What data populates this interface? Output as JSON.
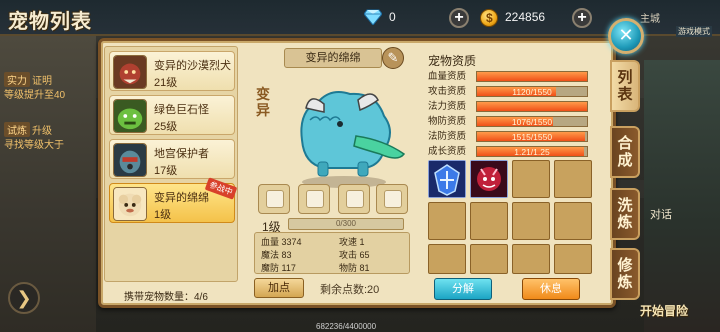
{
  "header": {
    "title": "宠物列表",
    "gems": "0",
    "coins": "224856",
    "minimap_label": "主城",
    "mode_label": "游戏模式"
  },
  "left_hints": [
    {
      "tag": "实力",
      "text": "证明"
    },
    {
      "tag": "",
      "text": "等级提升至40"
    },
    {
      "tag": "试炼",
      "text": "升级"
    },
    {
      "tag": "",
      "text": "寻找等级大于"
    }
  ],
  "pets": [
    {
      "name": "变异的沙漠烈犬",
      "level": "21级",
      "color": "#b04030"
    },
    {
      "name": "绿色巨石怪",
      "level": "25级",
      "color": "#4a9a30"
    },
    {
      "name": "地宫保护者",
      "level": "17级",
      "color": "#5a7a8a"
    },
    {
      "name": "变异的绵绵",
      "level": "1级",
      "color": "#e8d2a8",
      "selected": true,
      "badge": "参战中"
    }
  ],
  "carry_label": "携带宠物数量：4/6",
  "selected_pet": {
    "name": "变异的绵绵",
    "variant_tag": "变异",
    "level_label": "1级",
    "exp": "0/300",
    "stats": {
      "hp_label": "血量",
      "hp": "3374",
      "atk_speed_label": "攻速",
      "atk_speed": "1",
      "mp_label": "魔法",
      "mp": "83",
      "atk_label": "攻击",
      "atk": "65",
      "mdef_label": "魔防",
      "mdef": "117",
      "pdef_label": "物防",
      "pdef": "81"
    },
    "add_point_label": "加点",
    "remaining_points": "剩余点数:20"
  },
  "aptitude": {
    "title": "宠物资质",
    "rows": [
      {
        "label": "血量资质",
        "value": "",
        "fill": 1.0
      },
      {
        "label": "攻击资质",
        "value": "1120/1550",
        "fill": 0.72
      },
      {
        "label": "法力资质",
        "value": "",
        "fill": 1.0
      },
      {
        "label": "物防资质",
        "value": "1076/1550",
        "fill": 0.69
      },
      {
        "label": "法防资质",
        "value": "1515/1550",
        "fill": 0.98
      },
      {
        "label": "成长资质",
        "value": "1.21/1.25",
        "fill": 0.97
      }
    ]
  },
  "actions": {
    "decompose": "分解",
    "rest": "休息"
  },
  "side_tabs": [
    {
      "label": "列表",
      "active": true
    },
    {
      "label": "合成",
      "active": false
    },
    {
      "label": "洗炼",
      "active": false
    },
    {
      "label": "修炼",
      "active": false
    }
  ],
  "right_labels": {
    "chat": "对话",
    "start": "开始冒险"
  },
  "footer_xp": "682236/4400000"
}
